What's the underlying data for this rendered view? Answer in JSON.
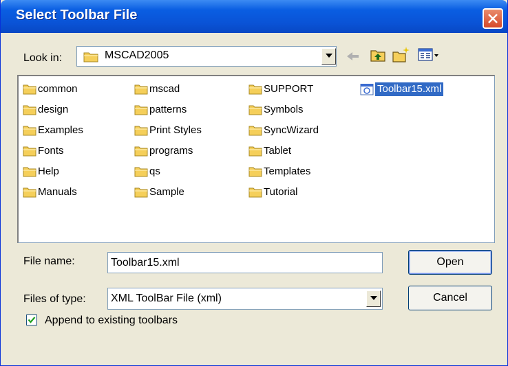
{
  "window": {
    "title": "Select Toolbar File"
  },
  "look_in": {
    "label": "Look in:",
    "value": "MSCAD2005"
  },
  "toolbar": {
    "icons": [
      "back-arrow-icon",
      "up-folder-icon",
      "new-folder-icon",
      "view-menu-icon"
    ]
  },
  "files": {
    "col1": [
      "common",
      "design",
      "Examples",
      "Fonts",
      "Help",
      "Manuals"
    ],
    "col2": [
      "mscad",
      "patterns",
      "Print Styles",
      "programs",
      "qs",
      "Sample"
    ],
    "col3": [
      "SUPPORT",
      "Symbols",
      "SyncWizard",
      "Tablet",
      "Templates",
      "Tutorial"
    ],
    "selected_file": "Toolbar15.xml"
  },
  "file_name": {
    "label": "File name:",
    "value": "Toolbar15.xml"
  },
  "file_type": {
    "label": "Files of type:",
    "value": "XML ToolBar File (xml)"
  },
  "buttons": {
    "open": "Open",
    "cancel": "Cancel"
  },
  "append": {
    "label": "Append to existing toolbars",
    "checked": true
  },
  "colors": {
    "title_bar": "#0a5ee2",
    "selection": "#316ac5",
    "folder": "#f5cf5a"
  }
}
